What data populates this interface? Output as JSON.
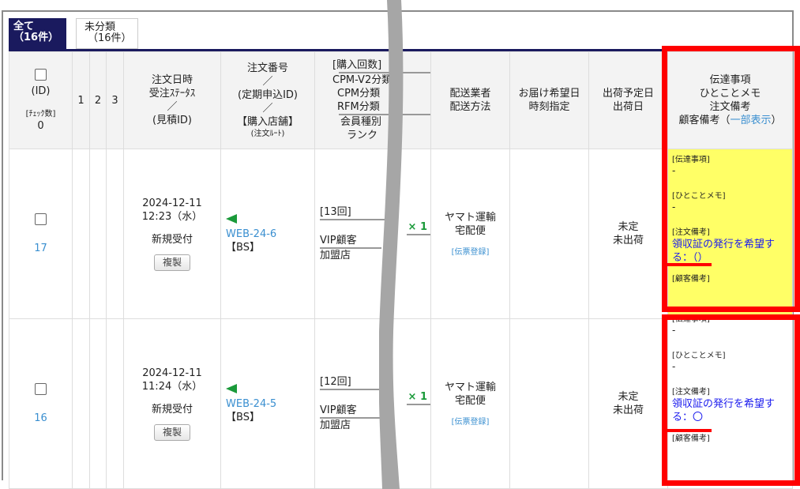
{
  "tabs": [
    {
      "label": "全て",
      "count": "（16件）",
      "active": true
    },
    {
      "label": "未分類",
      "count": "（16件）",
      "active": false
    }
  ],
  "headers": {
    "id": "(ID)",
    "check_count_label": "[ﾁｪｯｸ数]",
    "check_count": "0",
    "c1": "1",
    "c2": "2",
    "c3": "3",
    "date": [
      "注文日時",
      "受注ｽﾃｰﾀｽ",
      "／",
      "(見積ID)"
    ],
    "order": [
      "注文番号",
      "／",
      "(定期申込ID)",
      "／",
      "【購入店舗】",
      "(注文ﾙｰﾄ)"
    ],
    "purchase": [
      "[購入回数]",
      "CPM-V2分類",
      "CPM分類",
      "RFM分類",
      "会員種別",
      "ランク"
    ],
    "carrier": [
      "配送業者",
      "配送方法"
    ],
    "delivery": [
      "お届け希望日",
      "時刻指定"
    ],
    "ship": [
      "出荷予定日",
      "出荷日"
    ],
    "notes": [
      "伝達事項",
      "ひとことメモ",
      "注文備考",
      "顧客備考"
    ],
    "notes_link": "一部表示"
  },
  "rows": [
    {
      "id": "17",
      "date": "2024-12-11",
      "time": "12:23（水）",
      "status": "新規受付",
      "copy": "複製",
      "order_no": "WEB-24-6",
      "store": "【BS】",
      "count": "[13回]",
      "qty": "× 1",
      "member": "VIP顧客",
      "rank": "加盟店",
      "carrier": "ヤマト運輸",
      "method": "宅配便",
      "slip": "[伝票登録]",
      "ship1": "未定",
      "ship2": "未出荷",
      "n1": "[伝達事項]",
      "v1": "-",
      "n2": "[ひとことメモ]",
      "v2": "-",
      "n3": "[注文備考]",
      "v3": "領収証の発行を希望する：（）",
      "n4": "[顧客備考]"
    },
    {
      "id": "16",
      "date": "2024-12-11",
      "time": "11:24（水）",
      "status": "新規受付",
      "copy": "複製",
      "order_no": "WEB-24-5",
      "store": "【BS】",
      "count": "[12回]",
      "qty": "× 1",
      "member": "VIP顧客",
      "rank": "加盟店",
      "carrier": "ヤマト運輸",
      "method": "宅配便",
      "slip": "[伝票登録]",
      "ship1": "未定",
      "ship2": "未出荷",
      "n1": "[伝達事項]",
      "v1": "-",
      "n2": "[ひとことメモ]",
      "v2": "-",
      "n3": "[注文備考]",
      "v3": "領収証の発行を希望する：〇",
      "n4": "[顧客備考]"
    }
  ],
  "colors": {
    "tab_active": "#1a1a5e",
    "highlight": "#ffff66",
    "annotation": "#ff0000",
    "link": "#3a8fd0"
  }
}
